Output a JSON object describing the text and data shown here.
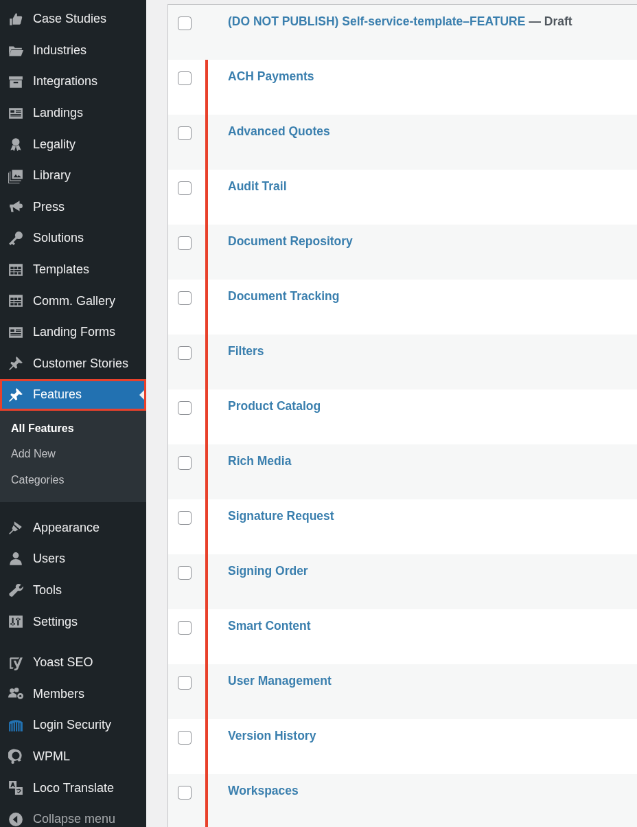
{
  "sidebar": {
    "sections": [
      [
        {
          "label": "Case Studies",
          "selected": false,
          "highlighted": false
        },
        {
          "label": "Industries",
          "selected": false,
          "highlighted": false
        },
        {
          "label": "Integrations",
          "selected": false,
          "highlighted": false
        },
        {
          "label": "Landings",
          "selected": false,
          "highlighted": false
        },
        {
          "label": "Legality",
          "selected": false,
          "highlighted": false
        },
        {
          "label": "Library",
          "selected": false,
          "highlighted": false
        },
        {
          "label": "Press",
          "selected": false,
          "highlighted": false
        },
        {
          "label": "Solutions",
          "selected": false,
          "highlighted": false
        },
        {
          "label": "Templates",
          "selected": false,
          "highlighted": false
        },
        {
          "label": "Comm. Gallery",
          "selected": false,
          "highlighted": false
        },
        {
          "label": "Landing Forms",
          "selected": false,
          "highlighted": false
        },
        {
          "label": "Customer Stories",
          "selected": false,
          "highlighted": false
        },
        {
          "label": "Features",
          "selected": true,
          "highlighted": true,
          "children": [
            {
              "label": "All Features",
              "selected": true
            },
            {
              "label": "Add New",
              "selected": false
            },
            {
              "label": "Categories",
              "selected": false
            }
          ]
        }
      ],
      [
        {
          "label": "Appearance",
          "selected": false,
          "highlighted": false
        },
        {
          "label": "Users",
          "selected": false,
          "highlighted": false
        },
        {
          "label": "Tools",
          "selected": false,
          "highlighted": false
        },
        {
          "label": "Settings",
          "selected": false,
          "highlighted": false
        }
      ],
      [
        {
          "label": "Yoast SEO",
          "selected": false,
          "highlighted": false
        },
        {
          "label": "Members",
          "selected": false,
          "highlighted": false
        },
        {
          "label": "Login Security",
          "selected": false,
          "highlighted": false
        },
        {
          "label": "WPML",
          "selected": false,
          "highlighted": false
        },
        {
          "label": "Loco Translate",
          "selected": false,
          "highlighted": false
        }
      ]
    ],
    "collapse_label": "Collapse menu"
  },
  "table": {
    "rows": [
      {
        "title": "(DO NOT PUBLISH) Self-service-template–FEATURE",
        "status": "— Draft",
        "checked": false,
        "marked": false
      },
      {
        "title": "ACH Payments",
        "checked": false,
        "marked": true
      },
      {
        "title": "Advanced Quotes",
        "checked": false,
        "marked": true
      },
      {
        "title": "Audit Trail",
        "checked": false,
        "marked": true
      },
      {
        "title": "Document Repository",
        "checked": false,
        "marked": true
      },
      {
        "title": "Document Tracking",
        "checked": false,
        "marked": true
      },
      {
        "title": "Filters",
        "checked": false,
        "marked": true
      },
      {
        "title": "Product Catalog",
        "checked": false,
        "marked": true
      },
      {
        "title": "Rich Media",
        "checked": false,
        "marked": true
      },
      {
        "title": "Signature Request",
        "checked": false,
        "marked": true
      },
      {
        "title": "Signing Order",
        "checked": false,
        "marked": true
      },
      {
        "title": "Smart Content",
        "checked": false,
        "marked": true
      },
      {
        "title": "User Management",
        "checked": false,
        "marked": true
      },
      {
        "title": "Version History",
        "checked": false,
        "marked": true
      },
      {
        "title": "Workspaces",
        "checked": false,
        "marked": true
      }
    ]
  }
}
